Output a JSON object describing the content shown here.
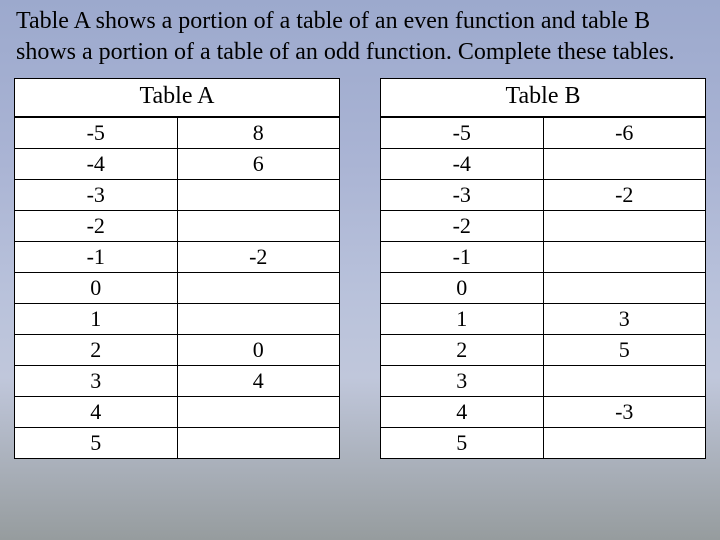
{
  "prompt_text": "Table A shows a portion of a table of an even function and table B shows a portion of a table of an odd function. Complete these tables.",
  "table_a": {
    "title": "Table A",
    "rows": [
      {
        "x": "-5",
        "y": "8"
      },
      {
        "x": "-4",
        "y": "6"
      },
      {
        "x": "-3",
        "y": ""
      },
      {
        "x": "-2",
        "y": ""
      },
      {
        "x": "-1",
        "y": "-2"
      },
      {
        "x": "0",
        "y": ""
      },
      {
        "x": "1",
        "y": ""
      },
      {
        "x": "2",
        "y": "0"
      },
      {
        "x": "3",
        "y": "4"
      },
      {
        "x": "4",
        "y": ""
      },
      {
        "x": "5",
        "y": ""
      }
    ]
  },
  "table_b": {
    "title": "Table B",
    "rows": [
      {
        "x": "-5",
        "y": "-6"
      },
      {
        "x": "-4",
        "y": ""
      },
      {
        "x": "-3",
        "y": "-2"
      },
      {
        "x": "-2",
        "y": ""
      },
      {
        "x": "-1",
        "y": ""
      },
      {
        "x": "0",
        "y": ""
      },
      {
        "x": "1",
        "y": "3"
      },
      {
        "x": "2",
        "y": "5"
      },
      {
        "x": "3",
        "y": ""
      },
      {
        "x": "4",
        "y": "-3"
      },
      {
        "x": "5",
        "y": ""
      }
    ]
  },
  "chart_data": [
    {
      "type": "table",
      "title": "Table A",
      "description": "partial values of an even function",
      "x": [
        -5,
        -4,
        -3,
        -2,
        -1,
        0,
        1,
        2,
        3,
        4,
        5
      ],
      "y": [
        8,
        6,
        null,
        null,
        -2,
        null,
        null,
        0,
        4,
        null,
        null
      ]
    },
    {
      "type": "table",
      "title": "Table B",
      "description": "partial values of an odd function",
      "x": [
        -5,
        -4,
        -3,
        -2,
        -1,
        0,
        1,
        2,
        3,
        4,
        5
      ],
      "y": [
        -6,
        null,
        -2,
        null,
        null,
        null,
        3,
        5,
        null,
        -3,
        null
      ]
    }
  ]
}
